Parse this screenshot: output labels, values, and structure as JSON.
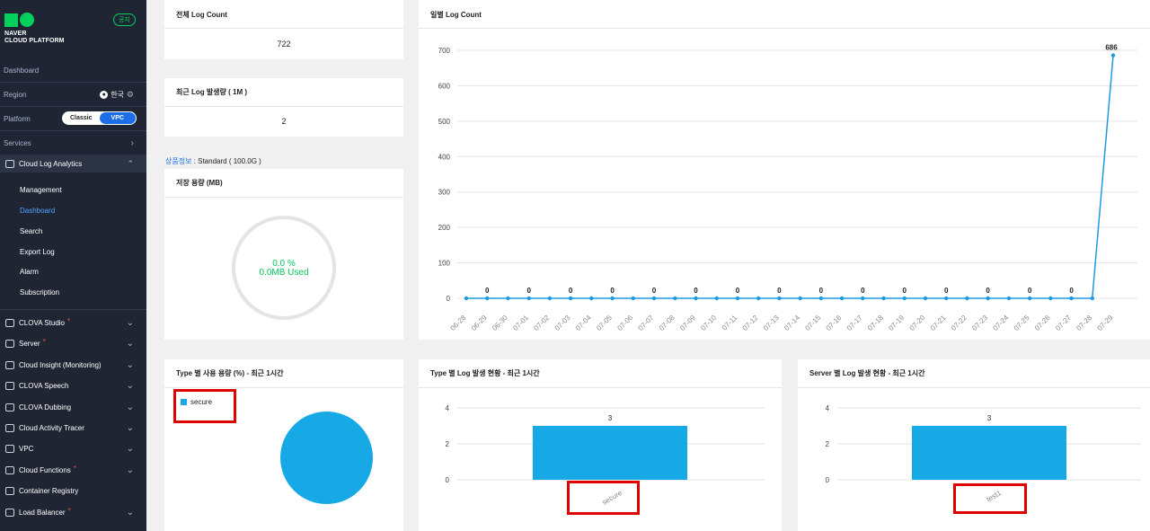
{
  "sidebar": {
    "logo_line1": "NAVER",
    "logo_line2": "CLOUD PLATFORM",
    "notice_badge": "공지",
    "dashboard": "Dashboard",
    "region_label": "Region",
    "region_value": "한국",
    "platform_label": "Platform",
    "platform_options": [
      "Classic",
      "VPC"
    ],
    "platform_selected": "VPC",
    "services_label": "Services",
    "active_service": "Cloud Log Analytics",
    "sub_items": [
      "Management",
      "Dashboard",
      "Search",
      "Export Log",
      "Alarm",
      "Subscription"
    ],
    "active_sub_item": "Dashboard",
    "services": [
      {
        "label": "CLOVA Studio",
        "required": true
      },
      {
        "label": "Server",
        "required": true
      },
      {
        "label": "Cloud Insight (Monitoring)",
        "required": false
      },
      {
        "label": "CLOVA Speech",
        "required": false
      },
      {
        "label": "CLOVA Dubbing",
        "required": false
      },
      {
        "label": "Cloud Activity Tracer",
        "required": false
      },
      {
        "label": "VPC",
        "required": false
      },
      {
        "label": "Cloud Functions",
        "required": true
      },
      {
        "label": "Container Registry",
        "required": false
      },
      {
        "label": "Load Balancer",
        "required": true
      }
    ]
  },
  "panels": {
    "total_log": {
      "title": "전체 Log Count",
      "value": "722"
    },
    "recent_log": {
      "title": "최근 Log 발생량 ( 1M )",
      "value": "2"
    },
    "product_info": {
      "label": "상품정보",
      "value": " : Standard ( 100.0G )"
    },
    "storage": {
      "title": "저장 용량 (MB)",
      "percent": "0.0 %",
      "used": "0.0MB Used"
    },
    "daily": {
      "title": "일별 Log Count"
    },
    "type_usage": {
      "title": "Type 별 사용 용량 (%) - 최근 1시간",
      "legend": "secure"
    },
    "type_count": {
      "title": "Type 별 Log 발생 현황 - 최근 1시간"
    },
    "server_count": {
      "title": "Server 별 Log 발생 현황 - 최근 1시간"
    }
  },
  "chart_data": [
    {
      "type": "line",
      "x": [
        "06-28",
        "06-29",
        "06-30",
        "07-01",
        "07-02",
        "07-03",
        "07-04",
        "07-05",
        "07-06",
        "07-07",
        "07-08",
        "07-09",
        "07-10",
        "07-11",
        "07-12",
        "07-13",
        "07-14",
        "07-15",
        "07-16",
        "07-17",
        "07-18",
        "07-19",
        "07-20",
        "07-21",
        "07-22",
        "07-23",
        "07-24",
        "07-25",
        "07-26",
        "07-27",
        "07-28",
        "07-29"
      ],
      "values": [
        0,
        0,
        0,
        0,
        0,
        0,
        0,
        0,
        0,
        0,
        0,
        0,
        0,
        0,
        0,
        0,
        0,
        0,
        0,
        0,
        0,
        0,
        0,
        0,
        0,
        0,
        0,
        0,
        0,
        0,
        0,
        686
      ],
      "data_labels": [
        "",
        "0",
        "",
        "0",
        "",
        "0",
        "",
        "0",
        "",
        "0",
        "",
        "0",
        "",
        "0",
        "",
        "0",
        "",
        "0",
        "",
        "0",
        "",
        "0",
        "",
        "0",
        "",
        "0",
        "",
        "0",
        "",
        "0",
        "",
        "686"
      ],
      "yticks": [
        0,
        100,
        200,
        300,
        400,
        500,
        600,
        700
      ],
      "ylim": [
        0,
        700
      ],
      "grid": true,
      "color": "#1c9ae0"
    },
    {
      "type": "pie",
      "categories": [
        "secure"
      ],
      "values": [
        100
      ],
      "color": "#17a9e6"
    },
    {
      "type": "bar",
      "categories": [
        "secure"
      ],
      "values": [
        3
      ],
      "yticks": [
        0,
        2,
        4
      ],
      "ylim": [
        0,
        4
      ],
      "color": "#17a9e6"
    },
    {
      "type": "bar",
      "categories": [
        "test1"
      ],
      "values": [
        3
      ],
      "yticks": [
        0,
        2,
        4
      ],
      "ylim": [
        0,
        4
      ],
      "color": "#17a9e6"
    }
  ]
}
